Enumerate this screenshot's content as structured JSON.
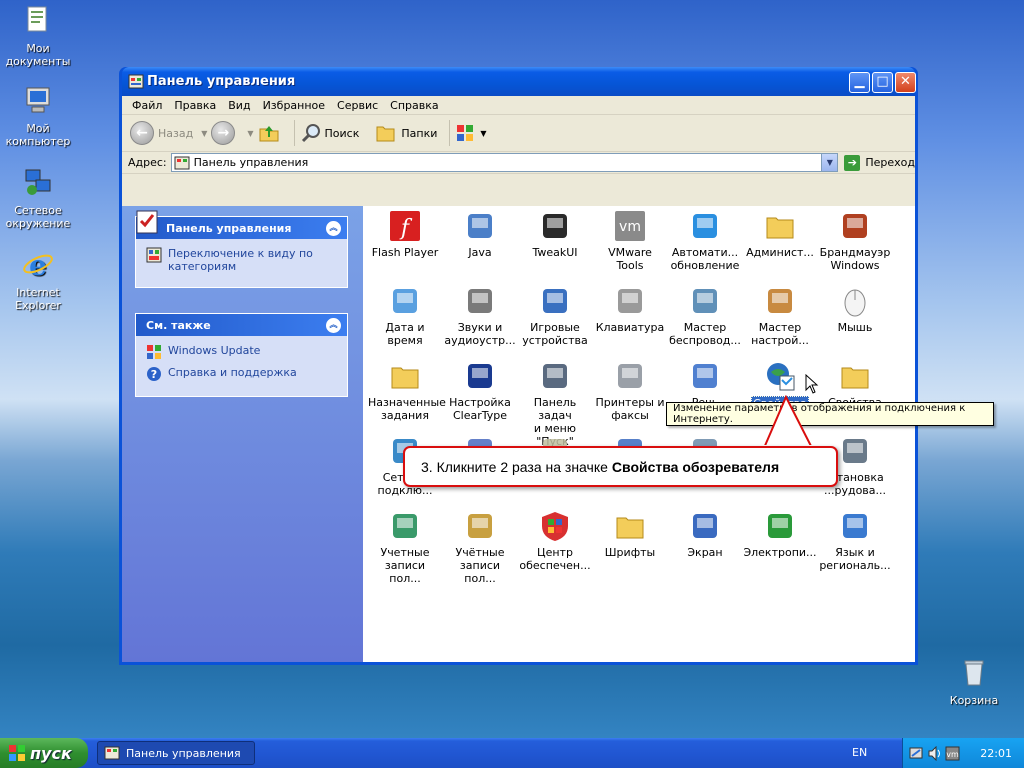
{
  "desktop": {
    "icons": [
      {
        "label_1": "Мои",
        "label_2": "документы",
        "icon": "my-documents-icon"
      },
      {
        "label_1": "Мой",
        "label_2": "компьютер",
        "icon": "my-computer-icon"
      },
      {
        "label_1": "Сетевое",
        "label_2": "окружение",
        "icon": "network-places-icon"
      },
      {
        "label_1": "Internet",
        "label_2": "Explorer",
        "icon": "internet-explorer-icon"
      }
    ],
    "recycle_bin": "Корзина"
  },
  "window": {
    "title": "Панель управления",
    "menu": [
      "Файл",
      "Правка",
      "Вид",
      "Избранное",
      "Сервис",
      "Справка"
    ],
    "toolbar": {
      "back": "Назад",
      "search": "Поиск",
      "folders": "Папки"
    },
    "address": {
      "label": "Адрес:",
      "value": "Панель управления",
      "go": "Переход"
    }
  },
  "left_pane": {
    "panel1": {
      "title": "Панель управления",
      "links": [
        {
          "l1": "Переключение к виду по",
          "l2": "категориям"
        }
      ]
    },
    "panel2": {
      "title": "См. также",
      "links": [
        "Windows Update",
        "Справка и поддержка"
      ]
    }
  },
  "items": [
    {
      "l1": "Flash Player",
      "l2": ""
    },
    {
      "l1": "Java",
      "l2": ""
    },
    {
      "l1": "TweakUI",
      "l2": ""
    },
    {
      "l1": "VMware Tools",
      "l2": ""
    },
    {
      "l1": "Автомати...",
      "l2": "обновление"
    },
    {
      "l1": "Админист...",
      "l2": ""
    },
    {
      "l1": "Брандмауэр",
      "l2": "Windows"
    },
    {
      "l1": "Дата и время",
      "l2": ""
    },
    {
      "l1": "Звуки и",
      "l2": "аудиоустр..."
    },
    {
      "l1": "Игровые",
      "l2": "устройства"
    },
    {
      "l1": "Клавиатура",
      "l2": ""
    },
    {
      "l1": "Мастер",
      "l2": "беспровод..."
    },
    {
      "l1": "Мастер",
      "l2": "настрой..."
    },
    {
      "l1": "Мышь",
      "l2": ""
    },
    {
      "l1": "Назначенные",
      "l2": "задания"
    },
    {
      "l1": "Настройка",
      "l2": "ClearType"
    },
    {
      "l1": "Панель задач",
      "l2": "и меню \"Пуск\""
    },
    {
      "l1": "Принтеры и",
      "l2": "факсы"
    },
    {
      "l1": "Речь",
      "l2": ""
    },
    {
      "l1": "Свойства",
      "l2": "обозревателя"
    },
    {
      "l1": "Свойства",
      "l2": "папки"
    },
    {
      "l1": "Сетев...",
      "l2": "подклю..."
    },
    {
      "l1": "",
      "l2": ""
    },
    {
      "l1": "",
      "l2": ""
    },
    {
      "l1": "",
      "l2": ""
    },
    {
      "l1": "",
      "l2": ""
    },
    {
      "l1": "",
      "l2": ""
    },
    {
      "l1": "...тановка",
      "l2": "...рудова..."
    },
    {
      "l1": "Учетные",
      "l2": "записи пол..."
    },
    {
      "l1": "Учётные",
      "l2": "записи пол..."
    },
    {
      "l1": "Центр",
      "l2": "обеспечен..."
    },
    {
      "l1": "Шрифты",
      "l2": ""
    },
    {
      "l1": "Экран",
      "l2": ""
    },
    {
      "l1": "Электропи...",
      "l2": ""
    },
    {
      "l1": "Язык и",
      "l2": "региональ..."
    }
  ],
  "tooltip": "Изменение параметров отображения и подключения к Интернету.",
  "callout": {
    "prefix": "3. Кликните 2 раза на значке",
    "bold": "Свойства обозревателя"
  },
  "taskbar": {
    "start": "пуск",
    "task": "Панель управления",
    "lang": "EN",
    "clock": "22:01"
  }
}
